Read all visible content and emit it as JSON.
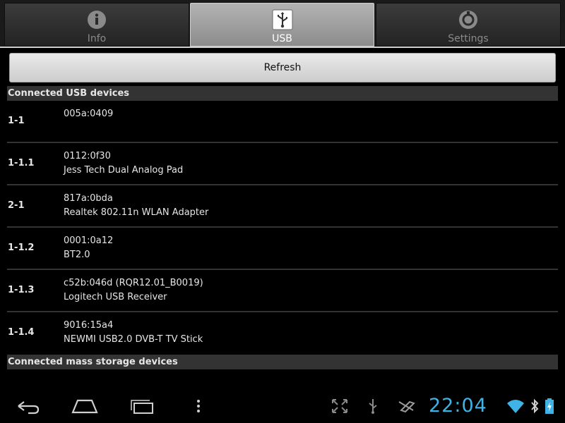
{
  "tabs": [
    {
      "label": "Info",
      "icon": "info-icon"
    },
    {
      "label": "USB",
      "icon": "usb-icon"
    },
    {
      "label": "Settings",
      "icon": "settings-icon"
    }
  ],
  "active_tab": "USB",
  "toolbar": {
    "refresh_label": "Refresh"
  },
  "sections": {
    "usb_devices": "Connected USB devices",
    "mass_storage": "Connected mass storage devices"
  },
  "devices": [
    {
      "address": "1-1",
      "id": "005a:0409",
      "name": ""
    },
    {
      "address": "1-1.1",
      "id": "0112:0f30",
      "name": "Jess Tech Dual Analog Pad"
    },
    {
      "address": "2-1",
      "id": "817a:0bda",
      "name": "Realtek 802.11n WLAN Adapter"
    },
    {
      "address": "1-1.2",
      "id": "0001:0a12",
      "name": "BT2.0"
    },
    {
      "address": "1-1.3",
      "id": "c52b:046d (RQR12.01_B0019)",
      "name": "Logitech USB Receiver"
    },
    {
      "address": "1-1.4",
      "id": "9016:15a4",
      "name": "NEWMI USB2.0 DVB-T TV Stick"
    }
  ],
  "status_bar": {
    "time": "22:04",
    "icons": [
      "screen-compat-icon",
      "usb-debug-icon",
      "airplane-icon",
      "wifi-icon",
      "bluetooth-icon",
      "battery-icon"
    ],
    "accent": "#3fb2e6"
  },
  "nav": [
    "back-icon",
    "home-icon",
    "recent-apps-icon",
    "menu-icon"
  ]
}
